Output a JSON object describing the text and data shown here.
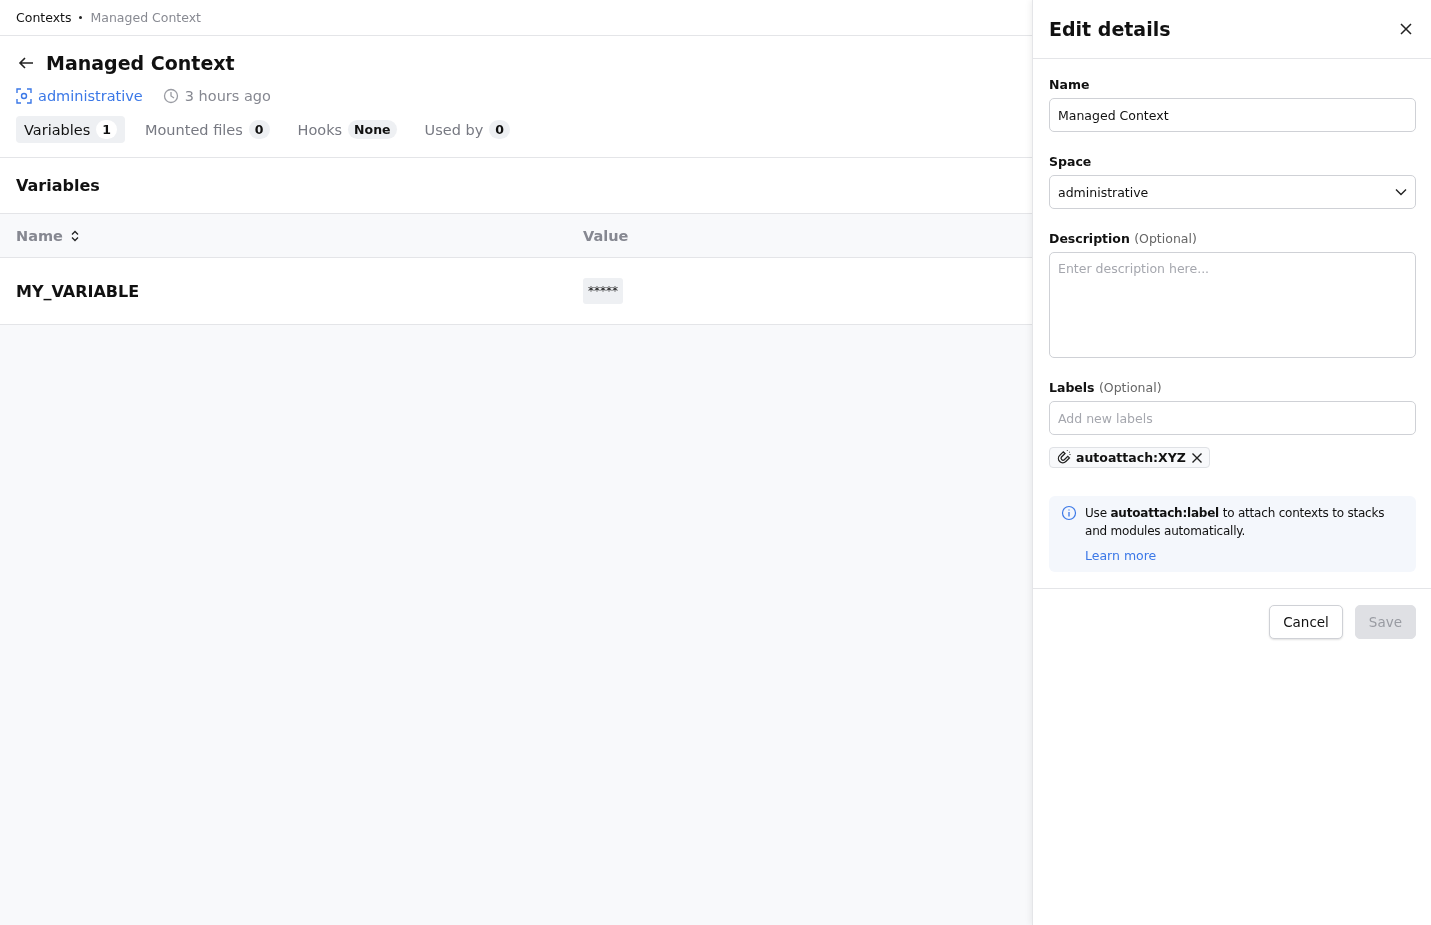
{
  "breadcrumb": [
    {
      "label": "Contexts",
      "current": false
    },
    {
      "label": "Managed Context",
      "current": true
    }
  ],
  "header": {
    "title": "Managed Context",
    "space": "administrative",
    "updated": "3 hours ago"
  },
  "tabs": [
    {
      "label": "Variables",
      "count": "1",
      "selected": true
    },
    {
      "label": "Mounted files",
      "count": "0",
      "selected": false
    },
    {
      "label": "Hooks",
      "count": "None",
      "selected": false
    },
    {
      "label": "Used by",
      "count": "0",
      "selected": false
    }
  ],
  "section_title": "Variables",
  "table": {
    "columns": [
      {
        "label": "Name",
        "sortable": true
      },
      {
        "label": "Value",
        "sortable": false
      }
    ],
    "rows": [
      {
        "name": "MY_VARIABLE",
        "value": "*****"
      }
    ]
  },
  "panel": {
    "title": "Edit details",
    "name_field": {
      "label": "Name",
      "value": "Managed Context"
    },
    "space_field": {
      "label": "Space",
      "value": "administrative"
    },
    "description_field": {
      "label": "Description",
      "hint": "(Optional)",
      "placeholder": "Enter description here..."
    },
    "labels_field": {
      "label": "Labels",
      "hint": "(Optional)",
      "placeholder": "Add new labels"
    },
    "labels": [
      "autoattach:XYZ"
    ],
    "info": {
      "text": "Use **autoattach:label** to attach contexts to stacks and modules automatically.",
      "link": "Learn more"
    },
    "buttons": [
      {
        "label": "Cancel",
        "disabled": false
      },
      {
        "label": "Save",
        "disabled": true
      }
    ]
  }
}
